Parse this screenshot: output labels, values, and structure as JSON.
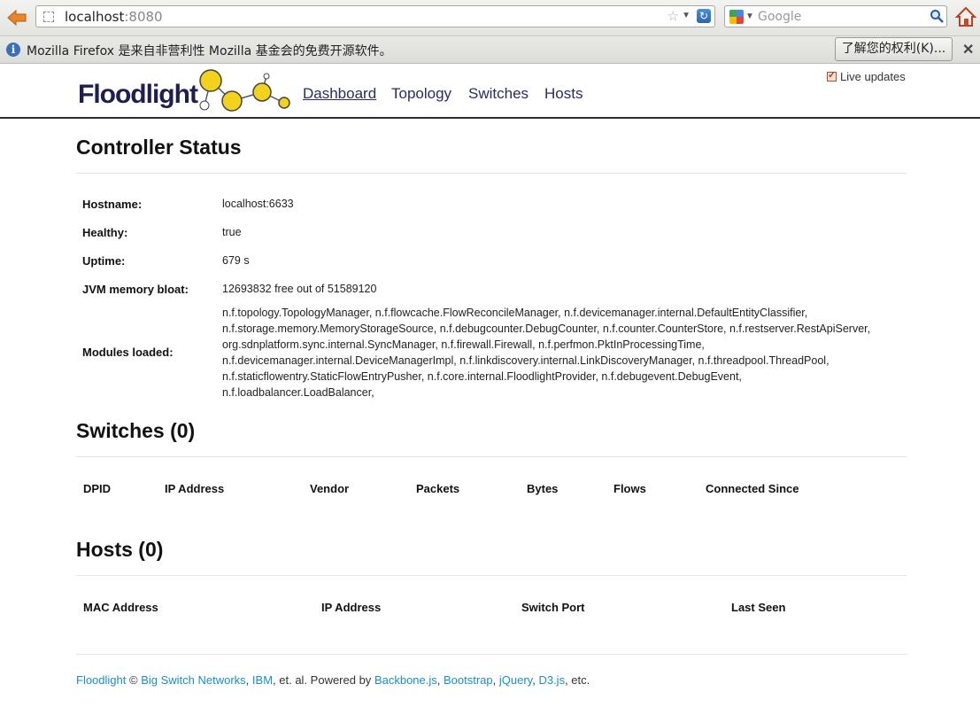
{
  "browser": {
    "url_host": "localhost",
    "url_port": ":8080",
    "search_placeholder": "Google",
    "infobar_text": "Mozilla Firefox 是来自非营利性 Mozilla 基金会的免费开源软件。",
    "infobar_button": "了解您的权利(K)..."
  },
  "header": {
    "logo_text": "Floodlight",
    "nav": [
      "Dashboard",
      "Topology",
      "Switches",
      "Hosts"
    ],
    "live_updates_label": "Live updates"
  },
  "controller": {
    "title": "Controller Status",
    "rows": [
      {
        "label": "Hostname:",
        "value": "localhost:6633"
      },
      {
        "label": "Healthy:",
        "value": "true"
      },
      {
        "label": "Uptime:",
        "value": "679 s"
      },
      {
        "label": "JVM memory bloat:",
        "value": "12693832 free out of 51589120"
      }
    ],
    "modules_label": "Modules loaded:",
    "modules_lines": [
      "n.f.topology.TopologyManager, n.f.flowcache.FlowReconcileManager, n.f.devicemanager.internal.DefaultEntityClassifier,",
      "n.f.storage.memory.MemoryStorageSource, n.f.debugcounter.DebugCounter, n.f.counter.CounterStore, n.f.restserver.RestApiServer,",
      "org.sdnplatform.sync.internal.SyncManager, n.f.firewall.Firewall, n.f.perfmon.PktInProcessingTime,",
      "n.f.devicemanager.internal.DeviceManagerImpl, n.f.linkdiscovery.internal.LinkDiscoveryManager, n.f.threadpool.ThreadPool,",
      "n.f.staticflowentry.StaticFlowEntryPusher, n.f.core.internal.FloodlightProvider, n.f.debugevent.DebugEvent,",
      "n.f.loadbalancer.LoadBalancer,"
    ]
  },
  "switches": {
    "title": "Switches (0)",
    "columns": [
      "DPID",
      "IP Address",
      "Vendor",
      "Packets",
      "Bytes",
      "Flows",
      "Connected Since"
    ]
  },
  "hosts": {
    "title": "Hosts (0)",
    "columns": [
      "MAC Address",
      "IP Address",
      "Switch Port",
      "Last Seen"
    ]
  },
  "footer": {
    "floodlight": "Floodlight",
    "copy": " © ",
    "bsn": "Big Switch Networks",
    "sep1": ", ",
    "ibm": "IBM",
    "mid": ", et. al. Powered by ",
    "backbone": "Backbone.js",
    "sep2": ", ",
    "bootstrap": "Bootstrap",
    "sep3": ", ",
    "jquery": "jQuery",
    "sep4": ", ",
    "d3": "D3.js",
    "end": ", etc."
  },
  "colors": {
    "link": "#1a8fc6",
    "nav": "#2b2b5e",
    "logo_ball": "#f2d21a"
  }
}
